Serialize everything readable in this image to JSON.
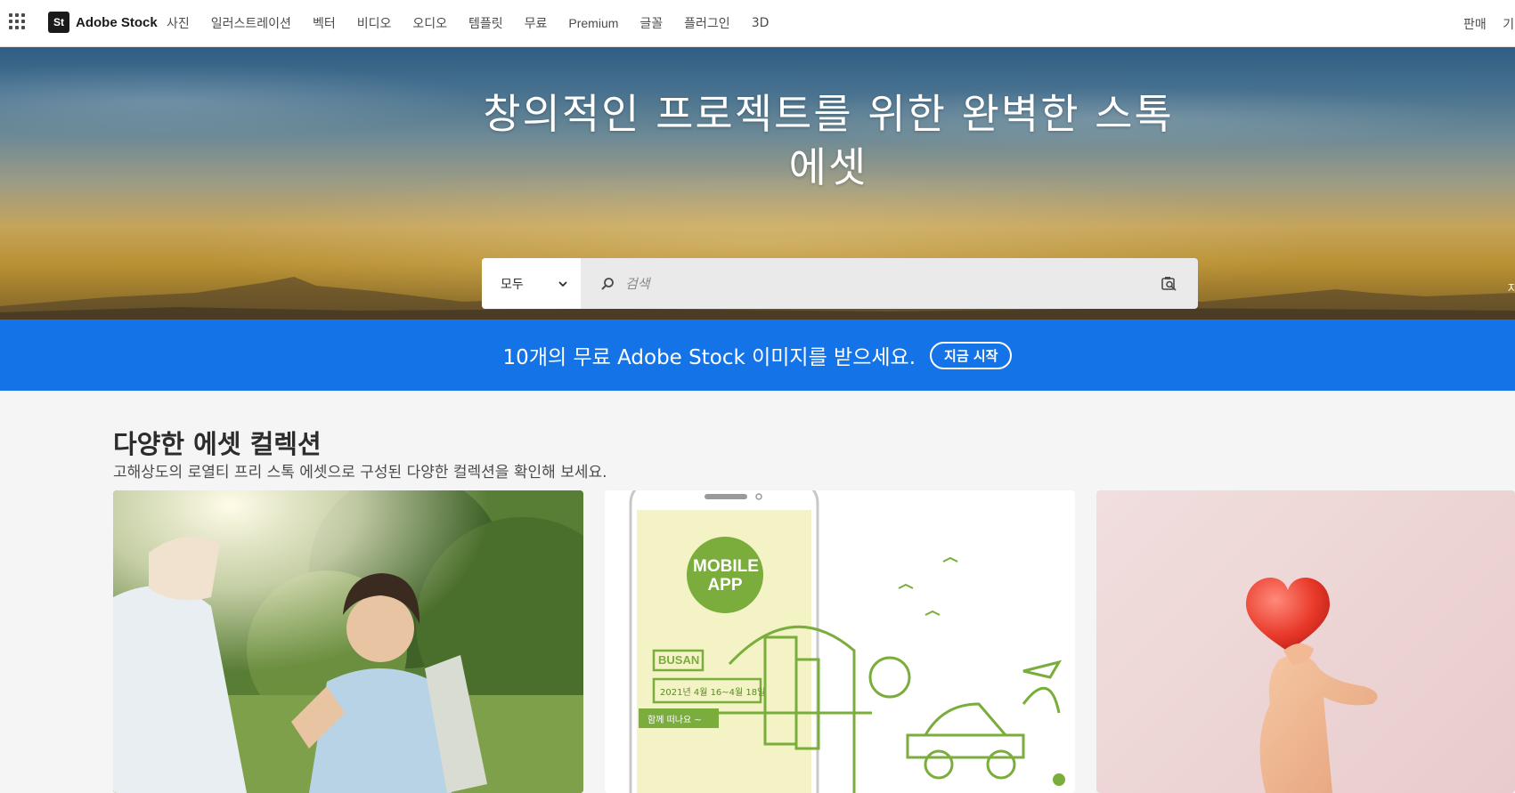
{
  "brand": {
    "logo_text": "St",
    "name": "Adobe Stock"
  },
  "nav": {
    "items": [
      "사진",
      "일러스트레이션",
      "벡터",
      "비디오",
      "오디오",
      "템플릿",
      "무료",
      "Premium",
      "글꼴",
      "플러그인",
      "3D"
    ],
    "right_label": "판매",
    "right_partial": "기"
  },
  "hero": {
    "title_line1": "창의적인 프로젝트를 위한 완벽한 스톡",
    "title_line2": "에셋",
    "search": {
      "category": "모두",
      "placeholder": "검색"
    },
    "edge_text": "자"
  },
  "promo": {
    "text": "10개의 무료 Adobe Stock 이미지를 받으세요.",
    "button": "지금 시작",
    "bg_color": "#1473e6"
  },
  "collections": {
    "title": "다양한 에셋 컬렉션",
    "subtitle": "고해상도의 로열티 프리 스톡 에셋으로 구성된 다양한 컬렉션을 확인해 보세요.",
    "cards": [
      {
        "kind": "photo"
      },
      {
        "kind": "illustration",
        "badge_line1": "MOBILE",
        "badge_line2": "APP",
        "sign": "BUSAN",
        "date": "2021년 4월 16~4월 18일",
        "tagline": "함께 떠나요 ~"
      },
      {
        "kind": "3d-render"
      }
    ]
  }
}
